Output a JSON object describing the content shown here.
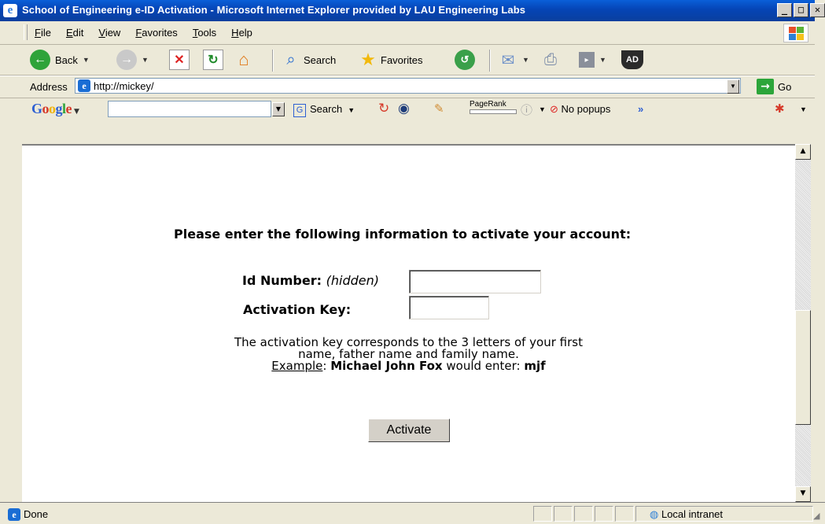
{
  "window": {
    "title": "School of Engineering e-ID Activation - Microsoft Internet Explorer provided by LAU Engineering Labs",
    "minimize": "_",
    "maximize": "□",
    "close": "✕"
  },
  "menu": {
    "items": [
      "File",
      "Edit",
      "View",
      "Favorites",
      "Tools",
      "Help"
    ]
  },
  "toolbar": {
    "back": "Back",
    "search": "Search",
    "favorites": "Favorites",
    "ad_label": "AD"
  },
  "address": {
    "label": "Address",
    "url": "http://mickey/",
    "go": "Go"
  },
  "google": {
    "logo": "Google",
    "search": "Search",
    "pagerank": "PageRank",
    "popups": "No popups",
    "more": "»"
  },
  "form": {
    "heading": "Please enter the following information to activate your account:",
    "id_label": "Id Number:",
    "id_hint": "(hidden)",
    "key_label": "Activation Key:",
    "note_line1": "The activation key corresponds to the 3 letters of your first",
    "note_line2": "name, father name and family name.",
    "example_label": "Example",
    "example_colon": ":",
    "example_name": "Michael John Fox",
    "example_mid": "would enter:",
    "example_key": "mjf",
    "activate": "Activate"
  },
  "status": {
    "text": "Done",
    "zone": "Local intranet"
  },
  "colors": {
    "titlebar": "#0a5fd8",
    "chrome": "#ece9d8",
    "go_green": "#2ca53a"
  }
}
